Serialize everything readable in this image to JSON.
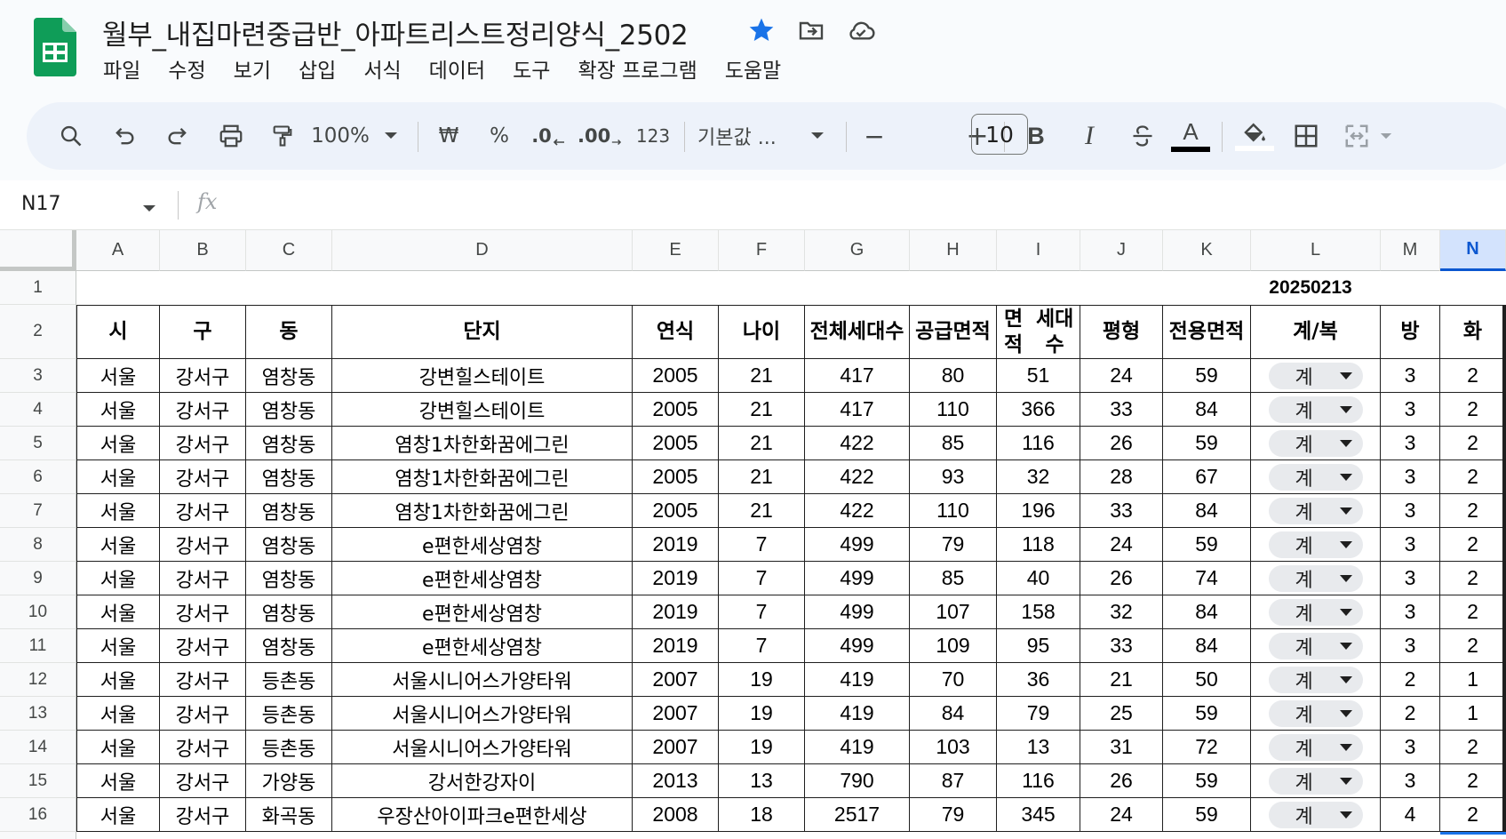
{
  "doc": {
    "title": "월부_내집마련중급반_아파트리스트정리양식_2502"
  },
  "menu": [
    "파일",
    "수정",
    "보기",
    "삽입",
    "서식",
    "데이터",
    "도구",
    "확장 프로그램",
    "도움말"
  ],
  "toolbar": {
    "zoom": "100%",
    "currency": "₩",
    "percent": "%",
    "dec_decrease": ".0",
    "dec_increase": ".00",
    "number_format": "123",
    "font": "기본값 ...",
    "font_size": "10",
    "minus": "−",
    "plus": "+",
    "bold": "B",
    "italic": "I",
    "text_color_letter": "A",
    "text_color": "#000000"
  },
  "formula": {
    "namebox": "N17",
    "fx": "fx"
  },
  "columns": [
    "A",
    "B",
    "C",
    "D",
    "E",
    "F",
    "G",
    "H",
    "I",
    "J",
    "K",
    "L",
    "M",
    "N"
  ],
  "selected_column": "N",
  "row_numbers": [
    "1",
    "2",
    "3",
    "4",
    "5",
    "6",
    "7",
    "8",
    "9",
    "10",
    "11",
    "12",
    "13",
    "14",
    "15",
    "16"
  ],
  "date": "20250213",
  "headers": [
    "시",
    "구",
    "동",
    "단지",
    "연식",
    "나이",
    "전체\n세대수",
    "공급\n면적",
    "면적\n세대수",
    "평형",
    "전용\n면적",
    "계/복",
    "방",
    "화"
  ],
  "rows": [
    [
      "서울",
      "강서구",
      "염창동",
      "강변힐스테이트",
      "2005",
      "21",
      "417",
      "80",
      "51",
      "24",
      "59",
      "계",
      "3",
      "2"
    ],
    [
      "서울",
      "강서구",
      "염창동",
      "강변힐스테이트",
      "2005",
      "21",
      "417",
      "110",
      "366",
      "33",
      "84",
      "계",
      "3",
      "2"
    ],
    [
      "서울",
      "강서구",
      "염창동",
      "염창1차한화꿈에그린",
      "2005",
      "21",
      "422",
      "85",
      "116",
      "26",
      "59",
      "계",
      "3",
      "2"
    ],
    [
      "서울",
      "강서구",
      "염창동",
      "염창1차한화꿈에그린",
      "2005",
      "21",
      "422",
      "93",
      "32",
      "28",
      "67",
      "계",
      "3",
      "2"
    ],
    [
      "서울",
      "강서구",
      "염창동",
      "염창1차한화꿈에그린",
      "2005",
      "21",
      "422",
      "110",
      "196",
      "33",
      "84",
      "계",
      "3",
      "2"
    ],
    [
      "서울",
      "강서구",
      "염창동",
      "e편한세상염창",
      "2019",
      "7",
      "499",
      "79",
      "118",
      "24",
      "59",
      "계",
      "3",
      "2"
    ],
    [
      "서울",
      "강서구",
      "염창동",
      "e편한세상염창",
      "2019",
      "7",
      "499",
      "85",
      "40",
      "26",
      "74",
      "계",
      "3",
      "2"
    ],
    [
      "서울",
      "강서구",
      "염창동",
      "e편한세상염창",
      "2019",
      "7",
      "499",
      "107",
      "158",
      "32",
      "84",
      "계",
      "3",
      "2"
    ],
    [
      "서울",
      "강서구",
      "염창동",
      "e편한세상염창",
      "2019",
      "7",
      "499",
      "109",
      "95",
      "33",
      "84",
      "계",
      "3",
      "2"
    ],
    [
      "서울",
      "강서구",
      "등촌동",
      "서울시니어스가양타워",
      "2007",
      "19",
      "419",
      "70",
      "36",
      "21",
      "50",
      "계",
      "2",
      "1"
    ],
    [
      "서울",
      "강서구",
      "등촌동",
      "서울시니어스가양타워",
      "2007",
      "19",
      "419",
      "84",
      "79",
      "25",
      "59",
      "계",
      "2",
      "1"
    ],
    [
      "서울",
      "강서구",
      "등촌동",
      "서울시니어스가양타워",
      "2007",
      "19",
      "419",
      "103",
      "13",
      "31",
      "72",
      "계",
      "3",
      "2"
    ],
    [
      "서울",
      "강서구",
      "가양동",
      "강서한강자이",
      "2013",
      "13",
      "790",
      "87",
      "116",
      "26",
      "59",
      "계",
      "3",
      "2"
    ],
    [
      "서울",
      "강서구",
      "화곡동",
      "우장산아이파크e편한세상",
      "2008",
      "18",
      "2517",
      "79",
      "345",
      "24",
      "59",
      "계",
      "4",
      "2"
    ]
  ]
}
